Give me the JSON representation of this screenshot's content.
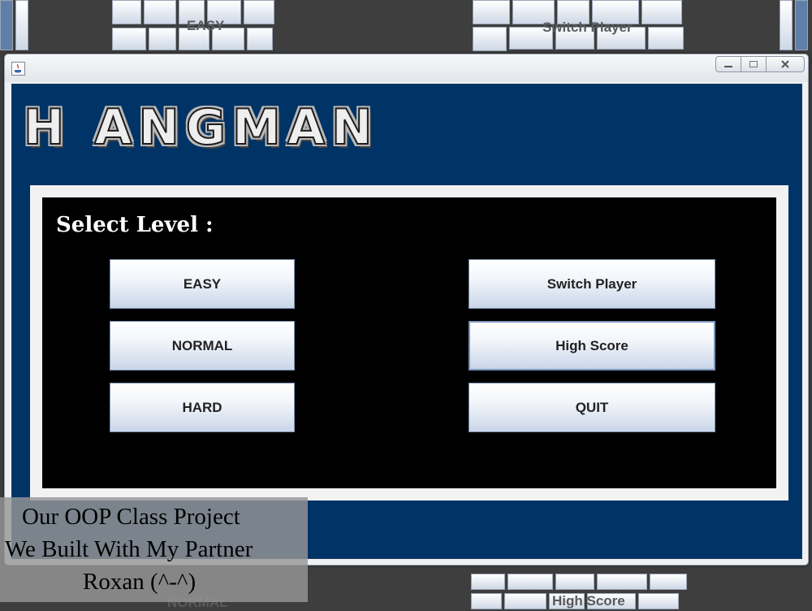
{
  "background": {
    "ghost_top_left": "EASY",
    "ghost_top_right": "Switch Player",
    "ghost_bottom_left": "NORMAL",
    "ghost_bottom_right": "High Score"
  },
  "window": {
    "icon": "java-icon",
    "controls": {
      "minimize": "minimize-icon",
      "maximize": "maximize-icon",
      "close": "close-icon"
    }
  },
  "logo": "H ANGMAN",
  "panel": {
    "label": "Select Level :",
    "level_buttons": [
      "EASY",
      "NORMAL",
      "HARD"
    ],
    "option_buttons": [
      "Switch Player",
      "High Score",
      "QUIT"
    ]
  },
  "caption": {
    "line1": "Our OOP Class Project",
    "line2": "We Built With My Partner",
    "line3": "Roxan (^-^)"
  },
  "colors": {
    "client_bg": "#003366",
    "panel_bg": "#000000",
    "button_gradient_bottom": "#c9d6e8"
  }
}
